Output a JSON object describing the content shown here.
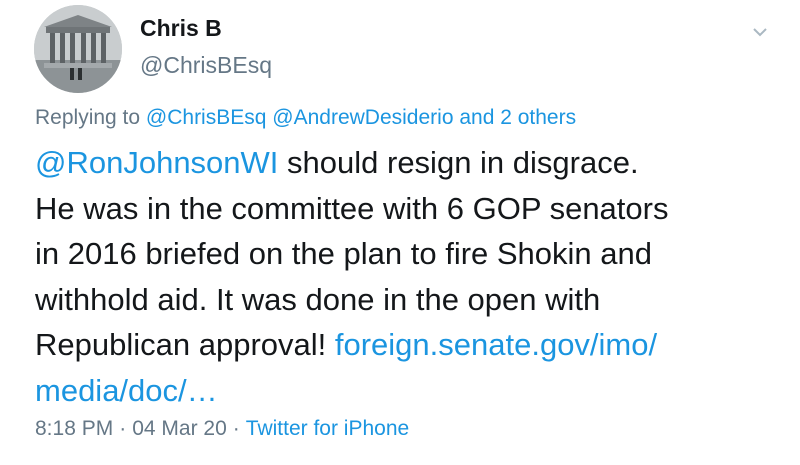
{
  "author": {
    "display_name": "Chris B",
    "handle": "@ChrisBEsq"
  },
  "icons": {
    "menu": "chevron-down-icon",
    "avatar": "courthouse-photo"
  },
  "reply": {
    "prefix": "Replying to ",
    "mention1": "@ChrisBEsq",
    "mention2": "@AndrewDesiderio",
    "others": "and 2 others"
  },
  "tweet": {
    "mention": "@RonJohnsonWI",
    "line1_rest": " should resign in disgrace.",
    "line2": "He was in the committee with 6 GOP senators",
    "line3": "in 2016 briefed on the plan to fire Shokin and",
    "line4": "withhold aid. It was done in the open with",
    "line5": "Republican approval! ",
    "link_part1": "foreign.senate.gov/imo/",
    "link_part2": "media/doc/…"
  },
  "meta": {
    "time": "8:18 PM",
    "separator": "·",
    "date": "04 Mar 20",
    "source": "Twitter for iPhone"
  },
  "colors": {
    "link": "#1b95e0",
    "secondary_text": "#657786",
    "primary_text": "#14171a"
  }
}
